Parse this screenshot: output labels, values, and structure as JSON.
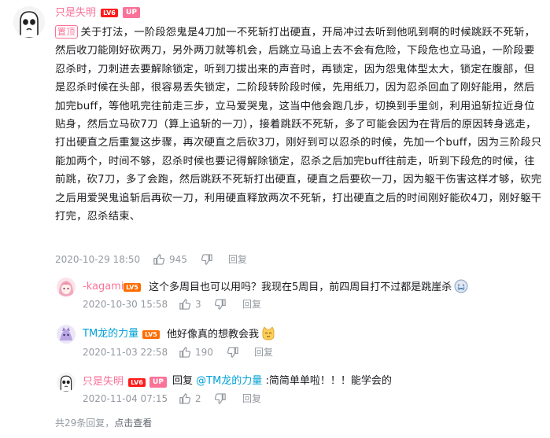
{
  "colors": {
    "pink_name": "#fb7299",
    "blue_name": "#00a1d6",
    "lv6": "#ff1b1b",
    "lv5": "#ff6c00",
    "meta_gray": "#9499a0"
  },
  "main_comment": {
    "username": "只是失明",
    "level": "LV6",
    "up_badge": "UP",
    "pinned_label": "置顶",
    "text": "关于打法，一阶段怨鬼是4刀加一不死斩打出硬直，开局冲过去听到他吼到啊的时候跳跃不死斩，然后收刀能刚好砍两刀，另外两刀就等机会，后跳立马追上去不会有危险，下段危也立马追，一阶段要忍杀时，刀刺进去要解除锁定，听到刀拔出来的声音时，再锁定，因为怨鬼体型太大，锁定在腹部，但是忍杀时候在头部，很容易丢失锁定，二阶段转阶段时候，先用纸刀，因为忍杀回血了刚好能用，然后加完buff，等他吼完往前走三步，立马爱哭鬼，这当中他会跑几步，切换到手里剑，利用追斩拉近身位贴身，然后立马砍7刀（算上追斩的一刀），接着跳跃不死斩，多了可能会因为在背后的原因转身逃走，打出硬直之后重复这步骤，再次硬直之后砍3刀，刚好到可以忍杀的时候，先加一个buff，因为三阶段只能加两个，时间不够，忍杀时候也要记得解除锁定，忍杀之后加完buff往前走，听到下段危的时候，往前跳，砍7刀，多了会跑，然后跳跃不死斩打出硬直，硬直之后要砍一刀，因为躯干伤害这样才够，砍完之后用爱哭鬼追斩后再砍一刀，利用硬直释放两次不死斩，打出硬直之后的时间刚好能砍4刀，刚好躯干打完，忍杀结束、",
    "date": "2020-10-29 18:50",
    "likes": "945",
    "reply_label": "回复",
    "like_icon": "thumbs-up-icon",
    "dislike_icon": "thumbs-down-icon"
  },
  "replies": [
    {
      "username": "-kagami",
      "level": "LV5",
      "text": "这个多周目也可以用吗？我现在5周目，前四周目打不过都是跳崖杀",
      "emoji": "crying-emoji-icon",
      "date": "2020-10-30 15:58",
      "likes": "3",
      "reply_label": "回复"
    },
    {
      "username": "TM龙的力量",
      "level": "LV5",
      "text": "他好像真的想教会我",
      "emoji": "cat-emoji-icon",
      "date": "2020-11-03 22:58",
      "likes": "190",
      "reply_label": "回复"
    },
    {
      "username": "只是失明",
      "level": "LV6",
      "up_badge": "UP",
      "text_prefix": "回复 ",
      "mention": "@TM龙的力量",
      "text_suffix": " :简简单单啦！！！能学会的",
      "date": "2020-11-04 07:15",
      "likes": "2",
      "reply_label": "回复"
    }
  ],
  "footer": {
    "count_text": "共29条回复，",
    "link_text": "点击查看"
  }
}
